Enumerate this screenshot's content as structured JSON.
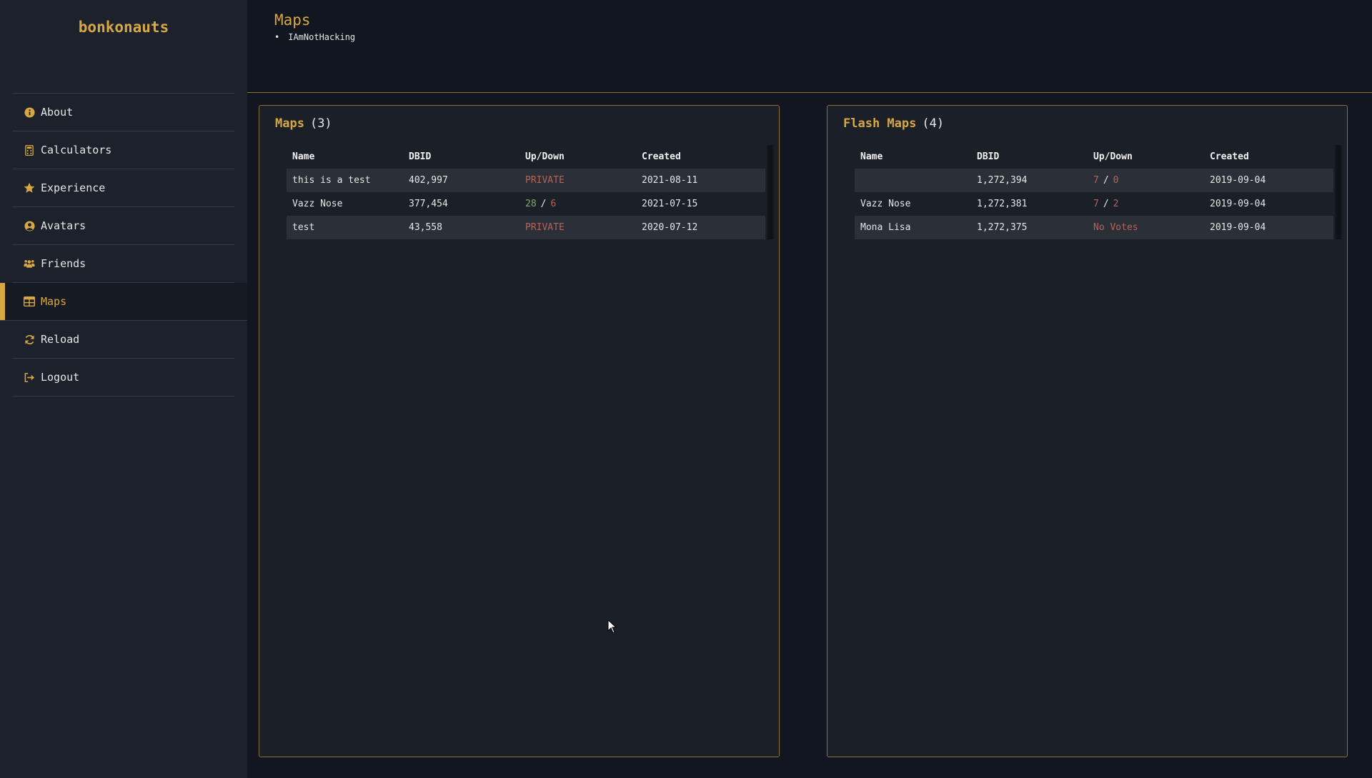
{
  "brand": "bonkonauts",
  "nav": [
    {
      "label": "About",
      "icon": "info-circle-icon",
      "active": false
    },
    {
      "label": "Calculators",
      "icon": "calculator-icon",
      "active": false
    },
    {
      "label": "Experience",
      "icon": "star-icon",
      "active": false
    },
    {
      "label": "Avatars",
      "icon": "user-circle-icon",
      "active": false
    },
    {
      "label": "Friends",
      "icon": "users-icon",
      "active": false
    },
    {
      "label": "Maps",
      "icon": "table-icon",
      "active": true
    },
    {
      "label": "Reload",
      "icon": "sync-icon",
      "active": false
    },
    {
      "label": "Logout",
      "icon": "sign-out-icon",
      "active": false
    }
  ],
  "header": {
    "title": "Maps",
    "users": [
      "IAmNotHacking"
    ]
  },
  "maps": {
    "title": "Maps",
    "count": "(3)",
    "columns": [
      "Name",
      "DBID",
      "Up/Down",
      "Created"
    ],
    "rows": [
      {
        "name": "this is a test",
        "dbid": "402,997",
        "vote": "PRIVATE",
        "up": "",
        "down": "",
        "created": "2021-08-11"
      },
      {
        "name": "Vazz Nose",
        "dbid": "377,454",
        "vote": "",
        "up": "28",
        "down": "6",
        "created": "2021-07-15"
      },
      {
        "name": "test",
        "dbid": "43,558",
        "vote": "PRIVATE",
        "up": "",
        "down": "",
        "created": "2020-07-12"
      }
    ]
  },
  "flash_maps": {
    "title": "Flash Maps",
    "count": "(4)",
    "columns": [
      "Name",
      "DBID",
      "Up/Down",
      "Created"
    ],
    "rows": [
      {
        "name": "",
        "dbid": "1,272,394",
        "vote": "",
        "up": "7",
        "down": "0",
        "created": "2019-09-04"
      },
      {
        "name": "Vazz Nose",
        "dbid": "1,272,381",
        "vote": "",
        "up": "7",
        "down": "2",
        "created": "2019-09-04"
      },
      {
        "name": "Mona Lisa",
        "dbid": "1,272,375",
        "vote": "No Votes",
        "up": "",
        "down": "",
        "created": "2019-09-04"
      }
    ]
  },
  "colors": {
    "accent": "#d7a742",
    "up": "#7fa870",
    "down": "#b76458",
    "background": "#121620",
    "sidebar": "#1d212b"
  }
}
